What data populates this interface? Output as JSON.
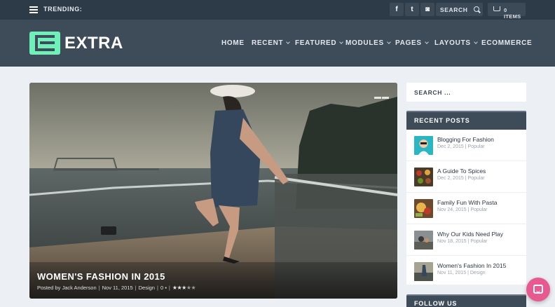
{
  "topbar": {
    "trending_label": "TRENDING:",
    "social": [
      {
        "icon": "facebook-icon",
        "glyph": "f"
      },
      {
        "icon": "twitter-icon",
        "glyph": "t"
      },
      {
        "icon": "instagram-icon",
        "glyph": "◙"
      }
    ],
    "search_label": "SEARCH",
    "cart_label": "0 ITEMS"
  },
  "header": {
    "logo_text": "EXTRA",
    "logo_color": "#6ff0b8",
    "nav": [
      {
        "label": "HOME",
        "has_dropdown": false
      },
      {
        "label": "RECENT",
        "has_dropdown": true
      },
      {
        "label": "FEATURED",
        "has_dropdown": true
      },
      {
        "label": "MODULES",
        "has_dropdown": true
      },
      {
        "label": "PAGES",
        "has_dropdown": true
      },
      {
        "label": "LAYOUTS",
        "has_dropdown": true
      },
      {
        "label": "ECOMMERCE",
        "has_dropdown": false
      }
    ]
  },
  "hero": {
    "title": "WOMEN'S FASHION IN 2015",
    "author_prefix": "Posted by",
    "author": "Jack Anderson",
    "date": "Nov 11, 2015",
    "category": "Design",
    "comments": "0",
    "rating": 2.5
  },
  "sidebar": {
    "search_placeholder": "SEARCH ...",
    "recent_title": "RECENT POSTS",
    "posts": [
      {
        "title": "Blogging For Fashion",
        "date": "Dec 2, 2015",
        "category": "Popular"
      },
      {
        "title": "A Guide To Spices",
        "date": "Dec 2, 2015",
        "category": "Popular"
      },
      {
        "title": "Family Fun With Pasta",
        "date": "Nov 24, 2015",
        "category": "Popular"
      },
      {
        "title": "Why Our Kids Need Play",
        "date": "Nov 18, 2015",
        "category": "Popular"
      },
      {
        "title": "Women's Fashion In 2015",
        "date": "Nov 11, 2015",
        "category": "Design"
      }
    ],
    "follow_title": "FOLLOW US"
  },
  "colors": {
    "topbar": "#2d3a47",
    "header": "#3e4b59",
    "accent": "#6ff0b8",
    "chat": "#e85a8f"
  }
}
